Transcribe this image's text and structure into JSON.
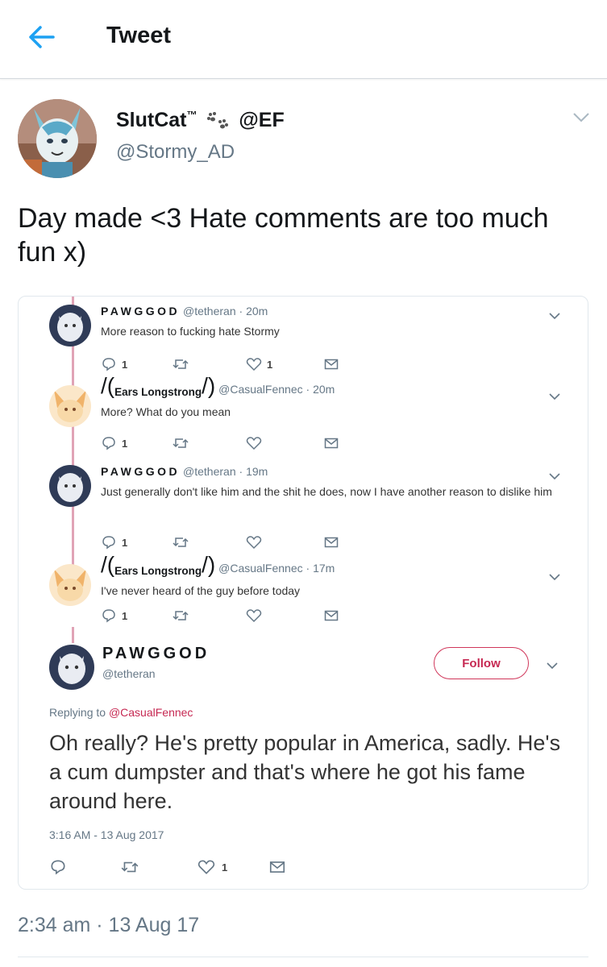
{
  "header": {
    "title": "Tweet"
  },
  "tweet": {
    "display_name": "SlutCat",
    "tm": "™",
    "name_suffix": "@EF",
    "handle": "@Stormy_AD",
    "text": "Day made <3 Hate comments are too much fun x)",
    "timestamp": "2:34 am · 13 Aug 17"
  },
  "embed": {
    "thread": [
      {
        "name": "PAWGGOD",
        "handle": "@tetheran",
        "time": "· 20m",
        "text": "More reason to fucking hate Stormy",
        "replies": "1",
        "retweets": "",
        "likes": "1"
      },
      {
        "name": "Ears Longstrong",
        "handle": "@CasualFennec",
        "time": "· 20m",
        "text": "More? What do you mean",
        "replies": "1",
        "retweets": "",
        "likes": ""
      },
      {
        "name": "PAWGGOD",
        "handle": "@tetheran",
        "time": "· 19m",
        "text": "Just generally don't like him and the shit he does, now I have another reason to dislike him",
        "replies": "1",
        "retweets": "",
        "likes": ""
      },
      {
        "name": "Ears Longstrong",
        "handle": "@CasualFennec",
        "time": "· 17m",
        "text": "I've never heard of the guy before today",
        "replies": "1",
        "retweets": "",
        "likes": ""
      }
    ],
    "main": {
      "name": "PAWGGOD",
      "handle": "@tetheran",
      "follow_label": "Follow",
      "replying_prefix": "Replying to ",
      "replying_to": "@CasualFennec",
      "text": "Oh really? He's pretty popular in America, sadly. He's a cum dumpster and that's where he got his fame around here.",
      "time": "3:16 AM - 13 Aug 2017",
      "likes": "1"
    }
  },
  "colors": {
    "accent": "#1da1f2",
    "follow": "#c62852",
    "thread_line": "#e0a3b6",
    "muted": "#657786"
  }
}
